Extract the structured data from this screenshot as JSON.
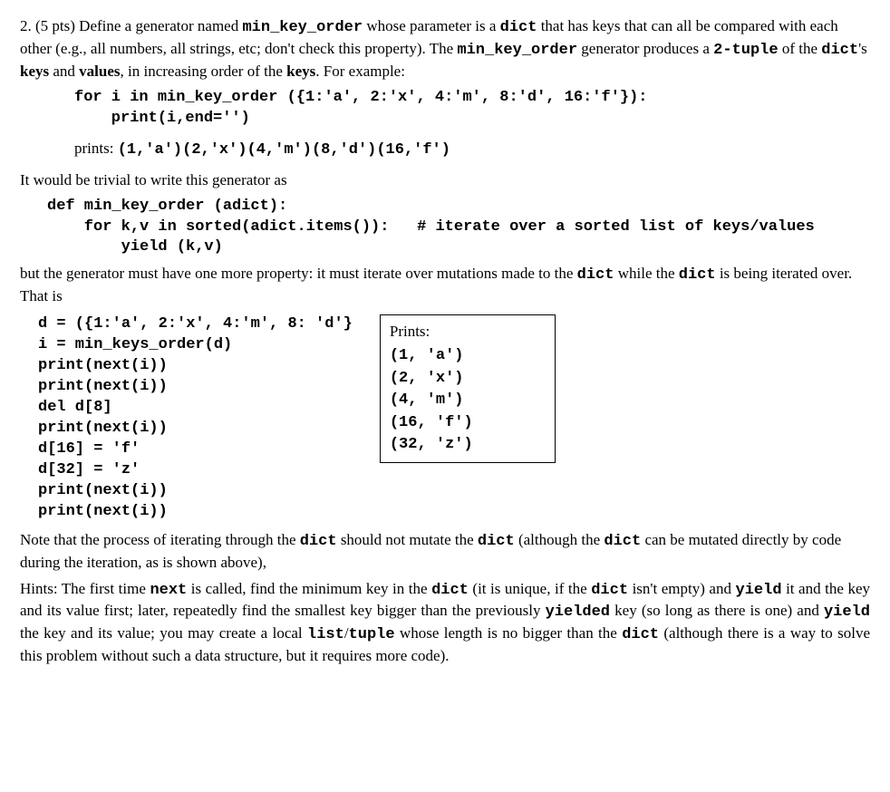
{
  "q": {
    "num": "2. (5  pts)  ",
    "p1a": "Define a generator named ",
    "code_min": "min_key_order",
    "p1b": " whose parameter is a ",
    "code_dict": "dict",
    "p1c": " that has keys that can all be compared with each other (e.g., all numbers, all strings, etc; don't check this property). The ",
    "p1d": " generator produces a ",
    "code_tuple": "2-tuple",
    "p1e": " of the ",
    "p1f": "'s ",
    "bold_keys": "keys",
    "p1g": " and ",
    "bold_values": "values",
    "p1h": ", in increasing order of the ",
    "p1i": ".  For example:"
  },
  "example1": "for i in min_key_order ({1:'a', 2:'x', 4:'m', 8:'d', 16:'f'}):\n    print(i,end='')",
  "prints": {
    "label": "prints: ",
    "out": "(1,'a')(2,'x')(4,'m')(8,'d')(16,'f')"
  },
  "trivial": "It would be trivial to write this generator as",
  "example2": "def min_key_order (adict):\n    for k,v in sorted(adict.items()):   # iterate over a sorted list of keys/values\n        yield (k,v)",
  "but": {
    "a": "but the generator must have one more property: it must iterate over mutations made to the ",
    "b": " while the ",
    "c": " is being iterated over. That is"
  },
  "left_code": "d = ({1:'a', 2:'x', 4:'m', 8: 'd'}\ni = min_keys_order(d)\nprint(next(i))\nprint(next(i))\ndel d[8]\nprint(next(i))\nd[16] = 'f'\nd[32] = 'z'\nprint(next(i))\nprint(next(i))",
  "right_box": {
    "label": "Prints:",
    "lines": "(1, 'a')\n(2, 'x')\n(4, 'm')\n(16, 'f')\n(32, 'z')"
  },
  "note": {
    "a": "Note that the process of iterating through the ",
    "b": " should not mutate the ",
    "c": " (although the ",
    "d": " can be mutated directly by code during the iteration, as is shown above),"
  },
  "hints": {
    "a": "Hints: The first time ",
    "code_next": "next",
    "b": " is called, find the minimum key in the ",
    "c": " (it is unique, if the ",
    "d": " isn't empty) and ",
    "code_yield": "yield",
    "e": " it and the key and its value first; later, repeatedly find the smallest key bigger than the previously ",
    "code_yielded": "yielded",
    "f": " key (so long as there is one) and ",
    "g": " the key and its value; you may create a local ",
    "code_list": "list",
    "slash": "/",
    "code_tuple2": "tuple",
    "h": " whose length is no bigger than the ",
    "i": " (although there is a way to solve this problem without such a data structure, but it requires more code)."
  }
}
